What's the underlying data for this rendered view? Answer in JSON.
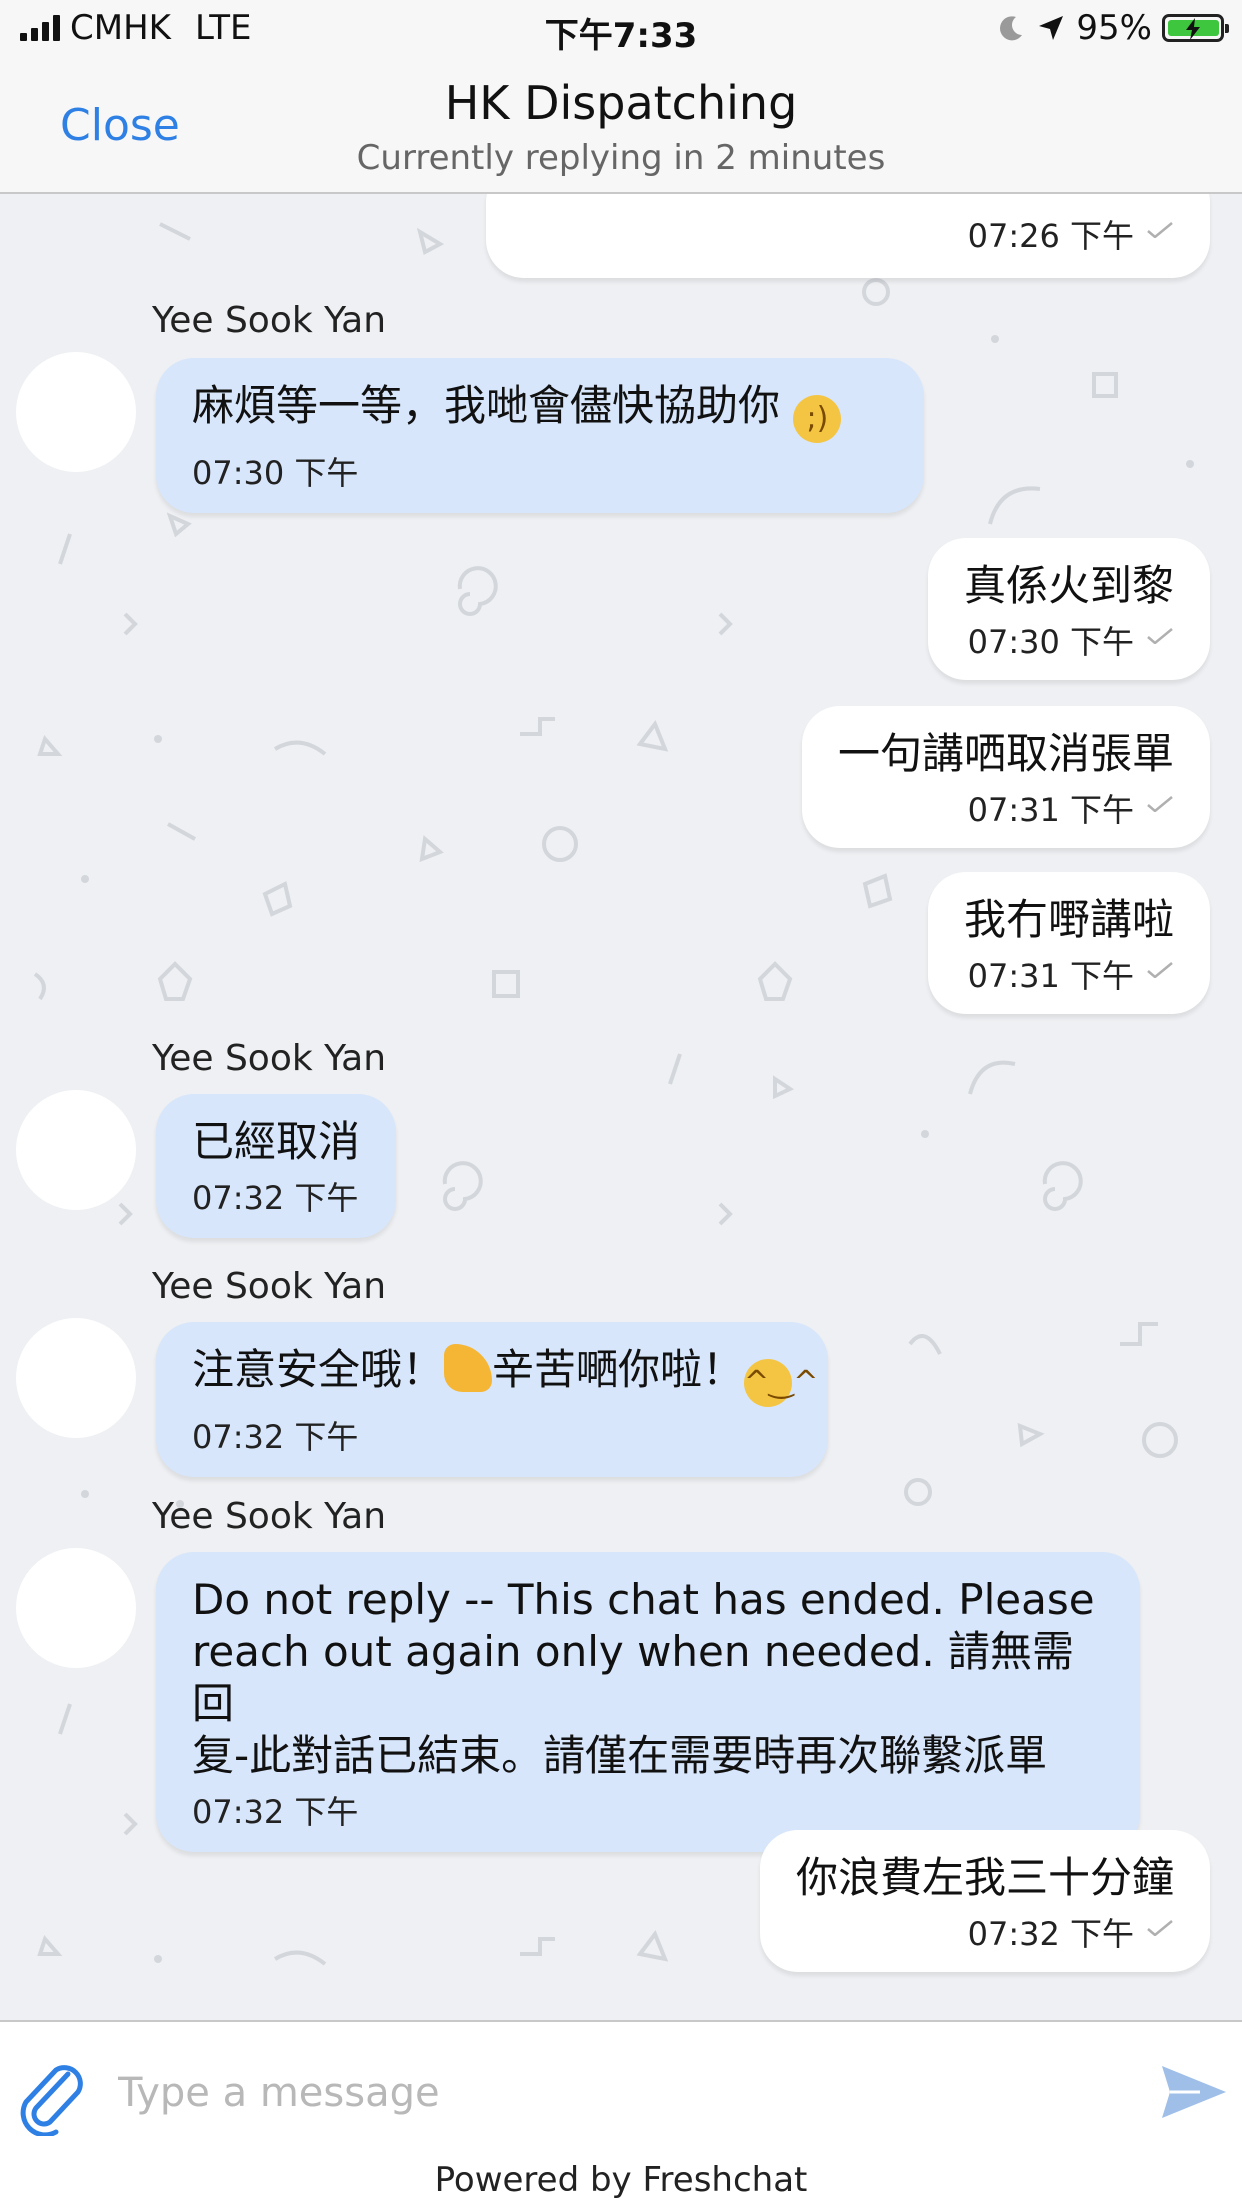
{
  "status_bar": {
    "carrier": "CMHK",
    "network": "LTE",
    "time": "下午7:33",
    "battery": "95%"
  },
  "header": {
    "close_label": "Close",
    "title": "HK Dispatching",
    "subtitle": "Currently replying in 2 minutes"
  },
  "messages": [
    {
      "time": "07:26 下午"
    },
    {
      "sender": "Yee Sook Yan",
      "text": "麻煩等一等，我哋會儘快協助你",
      "emoji": "wink",
      "time": "07:30 下午"
    },
    {
      "text": "真係火到黎",
      "time": "07:30 下午"
    },
    {
      "text": "一句講哂取消張單",
      "time": "07:31 下午"
    },
    {
      "text": "我冇嘢講啦",
      "time": "07:31 下午"
    },
    {
      "sender": "Yee Sook Yan",
      "text": "已經取消",
      "time": "07:32 下午"
    },
    {
      "sender": "Yee Sook Yan",
      "text_a": "注意安全哦！",
      "text_b": "辛苦嗮你啦！",
      "time": "07:32 下午"
    },
    {
      "sender": "Yee Sook Yan",
      "line1": "Do not reply -- This chat has ended. Please",
      "line2": "reach out again only when needed. 請無需回",
      "line3": "复-此對話已結束。請僅在需要時再次聯繫派單",
      "time": "07:32 下午"
    },
    {
      "text": "你浪費左我三十分鐘",
      "time": "07:32 下午"
    }
  ],
  "input": {
    "placeholder": "Type a message",
    "value": ""
  },
  "footer": {
    "powered_by": "Powered by Freshchat"
  },
  "icons": {
    "attach": "paperclip-icon",
    "send": "send-icon",
    "moon": "moon-icon",
    "location": "location-arrow-icon",
    "battery": "battery-charging-icon"
  },
  "colors": {
    "accent": "#2f80e4",
    "incoming_bubble": "#d7e6fb",
    "outgoing_bubble": "#ffffff",
    "background": "#eef0f3"
  }
}
